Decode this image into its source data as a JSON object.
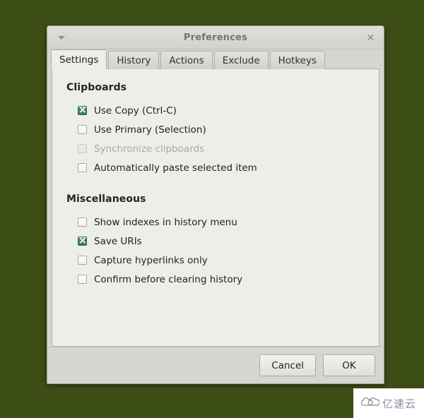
{
  "desktop": {
    "background_color": "#3d4d16"
  },
  "window": {
    "title": "Preferences",
    "menu_icon": "caret-down-icon",
    "close_icon": "close-icon",
    "close_glyph": "✕"
  },
  "tabs": [
    {
      "label": "Settings",
      "active": true
    },
    {
      "label": "History",
      "active": false
    },
    {
      "label": "Actions",
      "active": false
    },
    {
      "label": "Exclude",
      "active": false
    },
    {
      "label": "Hotkeys",
      "active": false
    }
  ],
  "sections": [
    {
      "heading": "Clipboards",
      "options": [
        {
          "label": "Use Copy (Ctrl-C)",
          "checked": true,
          "enabled": true
        },
        {
          "label": "Use Primary (Selection)",
          "checked": false,
          "enabled": true
        },
        {
          "label": "Synchronize clipboards",
          "checked": false,
          "enabled": false
        },
        {
          "label": "Automatically paste selected item",
          "checked": false,
          "enabled": true
        }
      ]
    },
    {
      "heading": "Miscellaneous",
      "options": [
        {
          "label": "Show indexes in history menu",
          "checked": false,
          "enabled": true
        },
        {
          "label": "Save URIs",
          "checked": true,
          "enabled": true
        },
        {
          "label": "Capture hyperlinks only",
          "checked": false,
          "enabled": true
        },
        {
          "label": "Confirm before clearing history",
          "checked": false,
          "enabled": true
        }
      ]
    }
  ],
  "footer": {
    "cancel_label": "Cancel",
    "ok_label": "OK"
  },
  "watermark": {
    "text": "亿速云",
    "icon": "cloud-icon",
    "color": "#8e8ea0"
  },
  "colors": {
    "checkbox_checked": "#3a7a5f",
    "window_chrome": "#d6d6d1",
    "content_panel": "#ededea",
    "disabled_text": "#a9a9a4"
  }
}
